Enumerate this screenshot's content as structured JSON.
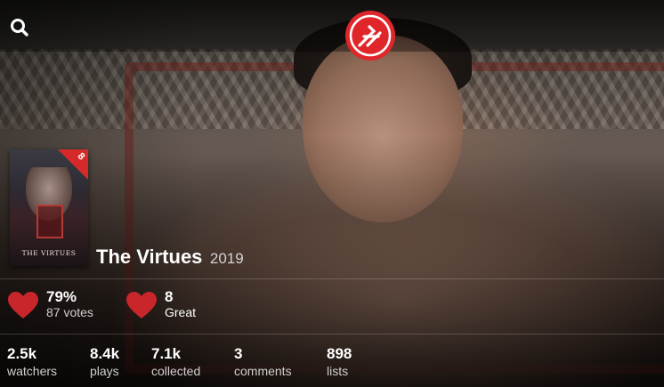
{
  "show": {
    "title": "The Virtues",
    "year": "2019",
    "poster_title": "THE VIRTUES",
    "poster_badge": "8"
  },
  "ratings": {
    "community": {
      "percent": "79%",
      "votes": "87 votes",
      "icon": "heart-icon"
    },
    "user": {
      "score": "8",
      "label": "Great",
      "icon": "heart-icon"
    }
  },
  "stats": [
    {
      "value": "2.5k",
      "label": "watchers"
    },
    {
      "value": "8.4k",
      "label": "plays"
    },
    {
      "value": "7.1k",
      "label": "collected"
    },
    {
      "value": "3",
      "label": "comments"
    },
    {
      "value": "898",
      "label": "lists"
    }
  ],
  "colors": {
    "accent_red": "#d62a2a",
    "heart_red": "#c8262b"
  },
  "icons": {
    "search": "search-icon",
    "logo": "trakt-logo-icon"
  }
}
